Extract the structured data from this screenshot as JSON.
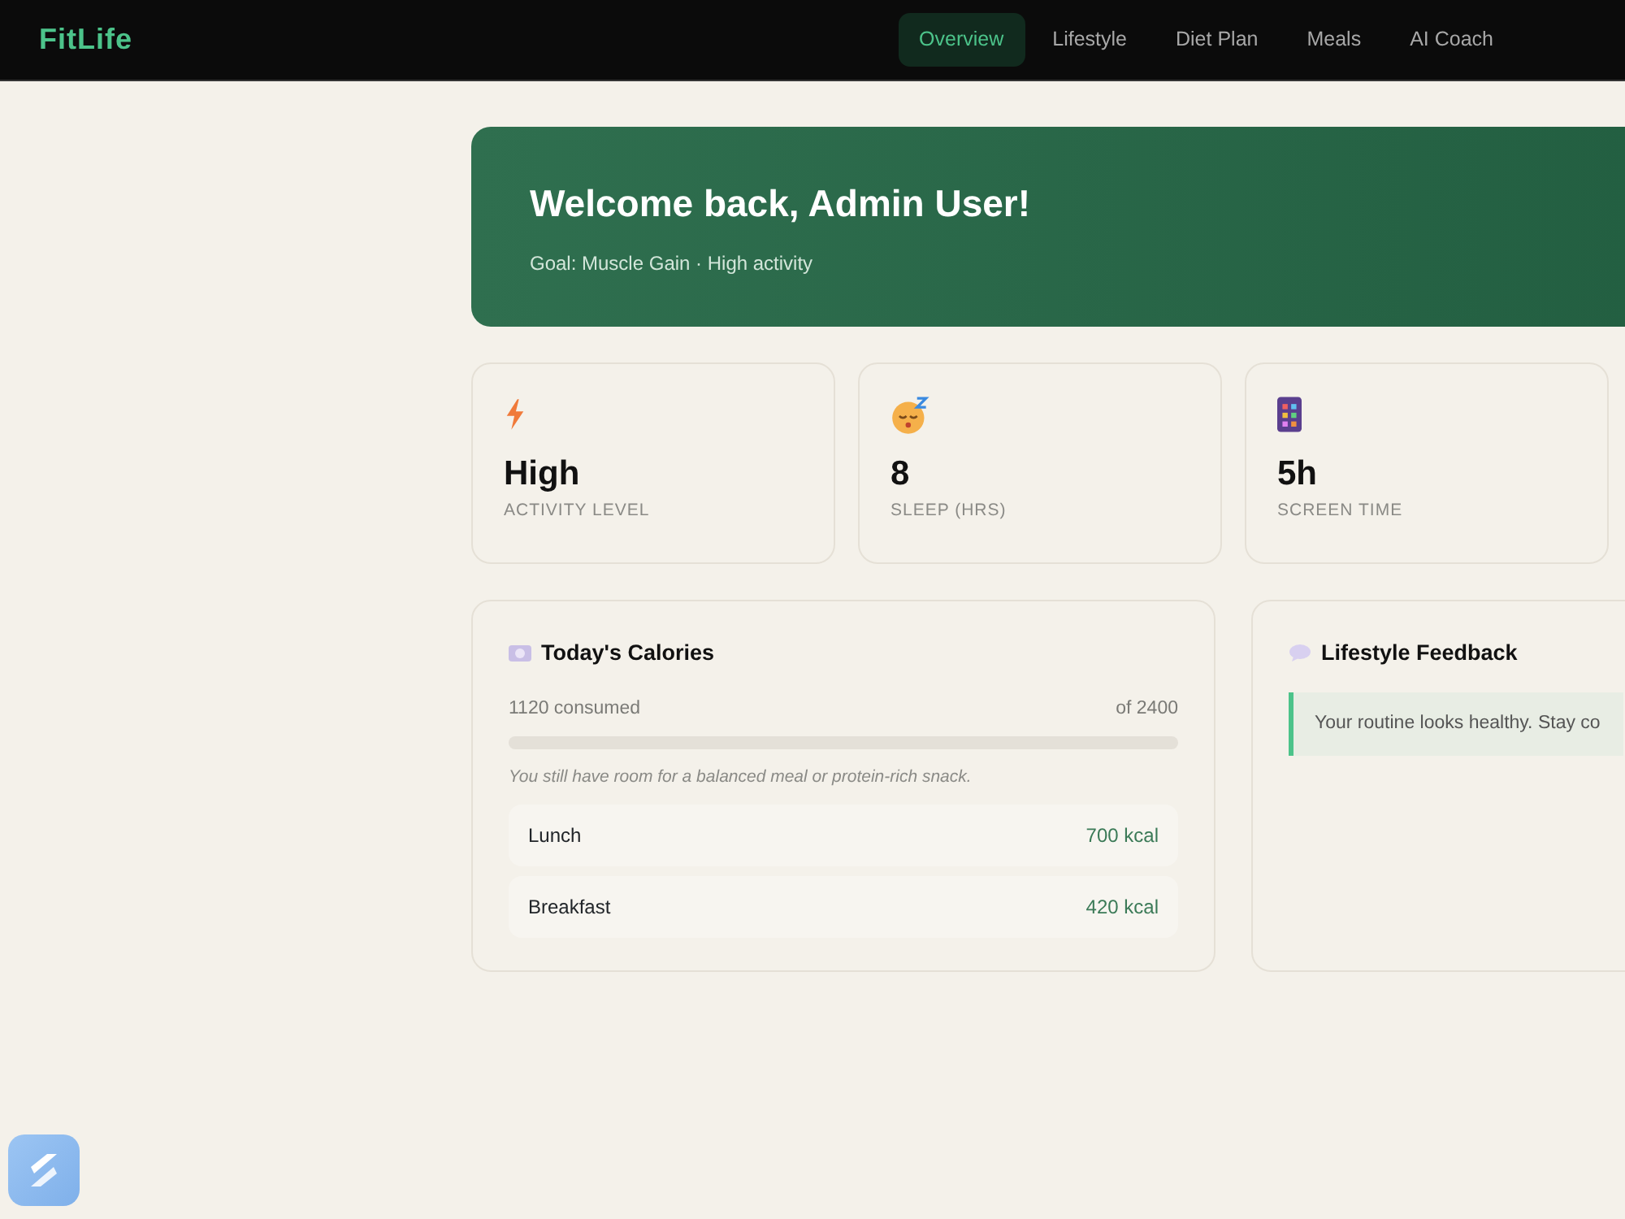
{
  "brand": "FitLife",
  "nav": [
    {
      "label": "Overview",
      "selected": true
    },
    {
      "label": "Lifestyle",
      "selected": false
    },
    {
      "label": "Diet Plan",
      "selected": false
    },
    {
      "label": "Meals",
      "selected": false
    },
    {
      "label": "AI Coach",
      "selected": false
    }
  ],
  "hero": {
    "title": "Welcome back, Admin User!",
    "subtitle": "Goal: Muscle Gain · High activity"
  },
  "stats": [
    {
      "kind": "bolt",
      "value": "High",
      "label": "ACTIVITY LEVEL"
    },
    {
      "kind": "sleep",
      "value": "8",
      "label": "SLEEP (HRS)"
    },
    {
      "kind": "device",
      "value": "5h",
      "label": "SCREEN TIME"
    }
  ],
  "calories": {
    "title": "Today's Calories",
    "consumed": "1120 consumed",
    "target": "of 2400",
    "level": 0,
    "note": "You still have room for a balanced meal or protein-rich snack.",
    "meals": [
      {
        "name": "Lunch",
        "kcal": "700 kcal"
      },
      {
        "name": "Breakfast",
        "kcal": "420 kcal"
      }
    ]
  },
  "feedback": {
    "title": "Lifestyle Feedback",
    "message": "Your routine looks healthy. Stay co"
  }
}
